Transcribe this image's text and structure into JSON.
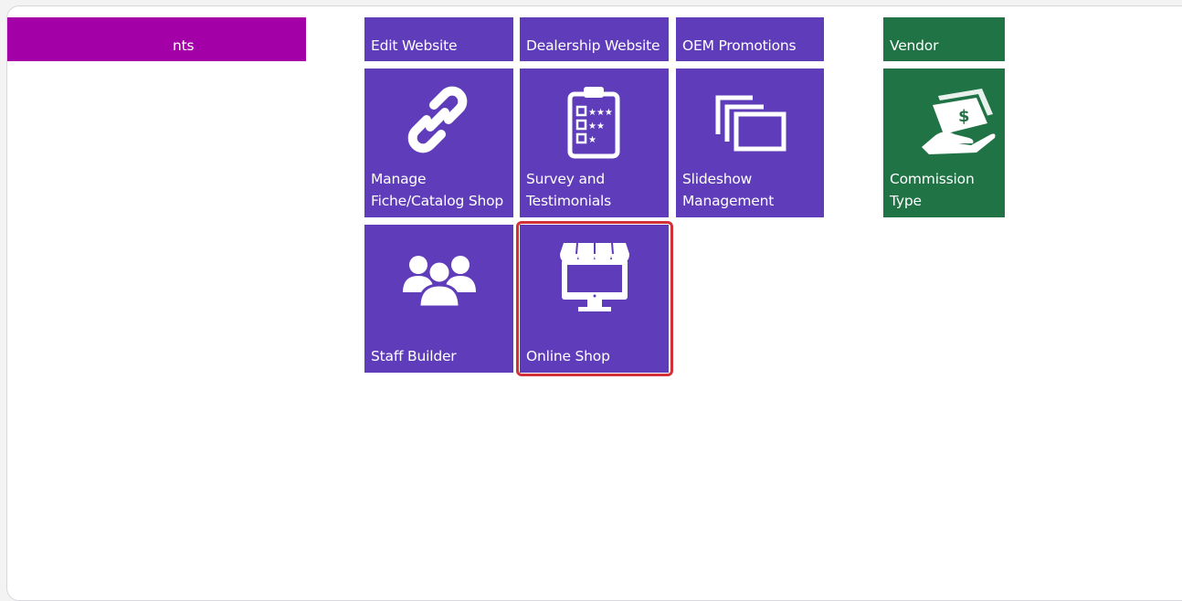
{
  "tiles": {
    "partial_left": {
      "label": "nts",
      "color": "#a300a7"
    },
    "edit_website": {
      "label": "Edit Website"
    },
    "dealership_website": {
      "label": "Dealership Website"
    },
    "oem_promotions": {
      "label": "OEM Promotions"
    },
    "vendor": {
      "label": "Vendor",
      "color": "#207345"
    },
    "manage_fiche": {
      "label": "Manage\nFiche/Catalog Shop",
      "icon": "link-icon"
    },
    "survey": {
      "label": "Survey and\nTestimonials",
      "icon": "clipboard-rating-icon"
    },
    "slideshow": {
      "label": "Slideshow\nManagement",
      "icon": "slides-icon"
    },
    "commission": {
      "label": "Commission Type",
      "icon": "money-hand-icon"
    },
    "staff_builder": {
      "label": "Staff Builder",
      "icon": "people-group-icon"
    },
    "online_shop": {
      "label": "Online Shop",
      "icon": "storefront-monitor-icon",
      "highlighted": true
    }
  },
  "colors": {
    "purple": "#5f3dba",
    "highlight": "#d3313a"
  }
}
